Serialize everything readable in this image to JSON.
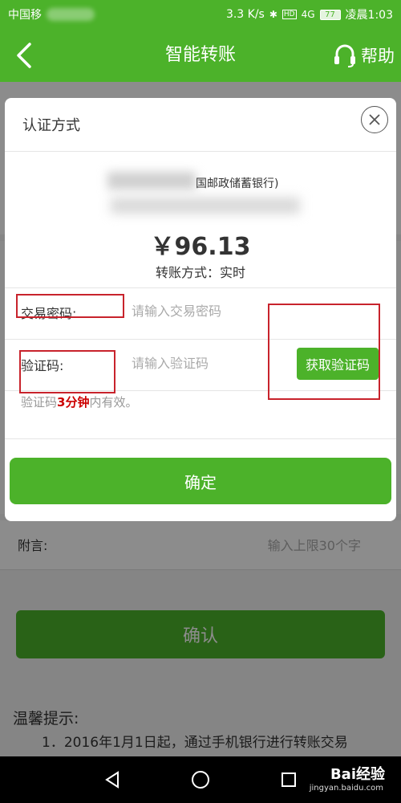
{
  "status_bar": {
    "carrier": "中国移",
    "speed": "3.3 K/s",
    "hd": "HD",
    "signal": "4G",
    "battery": "77",
    "time": "凌晨1:03"
  },
  "header": {
    "title": "智能转账",
    "help_label": "帮助"
  },
  "background_page": {
    "remark_label": "附言:",
    "remark_placeholder": "输入上限30个字",
    "confirm_label": "确认",
    "tips_title": "温馨提示:",
    "tips_line1": "1．2016年1月1日起，通过手机银行进行转账交易"
  },
  "dialog": {
    "title": "认证方式",
    "bank_name": "国邮政储蓄银行)",
    "amount": "￥96.13",
    "mode_text": "转账方式：实时",
    "password_label": "交易密码:",
    "password_placeholder": "请输入交易密码",
    "code_label": "验证码:",
    "code_placeholder": "请输入验证码",
    "get_code_label": "获取验证码",
    "hint_prefix": "验证码",
    "hint_highlight": "3分钟",
    "hint_suffix": "内有效。",
    "ok_label": "确定"
  },
  "watermark": {
    "brand": "Bai经验",
    "url": "jingyan.baidu.com"
  },
  "colors": {
    "brand_green": "#4cb22a",
    "annotation_red": "#c8232c",
    "hint_red": "#cc0000"
  }
}
